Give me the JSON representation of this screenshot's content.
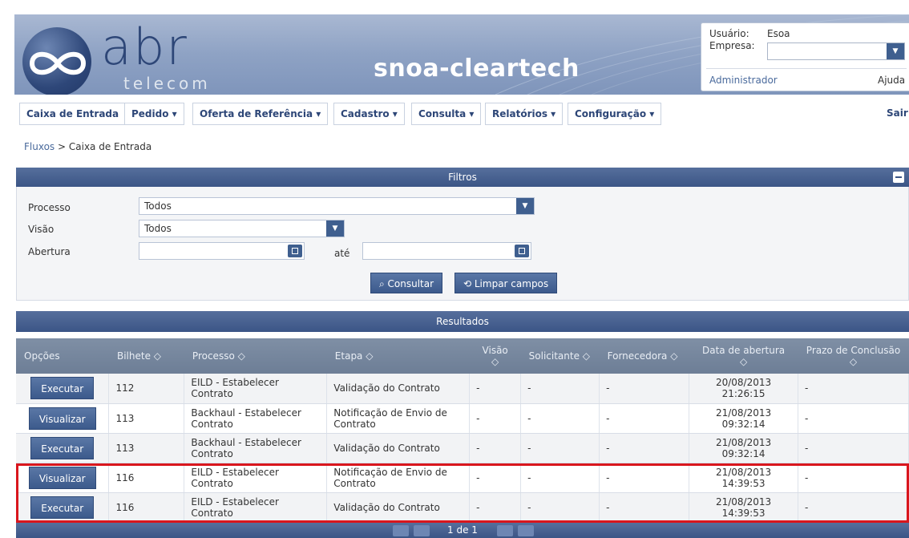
{
  "header": {
    "brand": "abr",
    "brand_sub": "telecom",
    "app_title": "snoa-cleartech"
  },
  "userbox": {
    "user_label": "Usuário:",
    "user_value": "Esoa",
    "company_label": "Empresa:",
    "company_value": "",
    "role": "Administrador",
    "help": "Ajuda"
  },
  "menu": {
    "items": [
      {
        "label": "Caixa de Entrada"
      },
      {
        "label": "Pedido ▾"
      },
      {
        "label": "Oferta de Referência ▾"
      },
      {
        "label": "Cadastro ▾"
      },
      {
        "label": "Consulta ▾"
      },
      {
        "label": "Relatórios ▾"
      },
      {
        "label": "Configuração ▾"
      }
    ],
    "exit": "Sair"
  },
  "breadcrumb": {
    "parent": "Fluxos",
    "separator": ">",
    "current": "Caixa de Entrada"
  },
  "filters": {
    "title": "Filtros",
    "processo_label": "Processo",
    "processo_value": "Todos",
    "visao_label": "Visão",
    "visao_value": "Todos",
    "abertura_label": "Abertura",
    "abertura_from": "",
    "ate_label": "até",
    "abertura_to": "",
    "consultar": "⌕ Consultar",
    "limpar": "⟲ Limpar campos"
  },
  "results": {
    "title": "Resultados",
    "columns": [
      "Opções",
      "Bilhete ◇",
      "Processo ◇",
      "Etapa ◇",
      "Visão ◇",
      "Solicitante ◇",
      "Fornecedora ◇",
      "Data de abertura ◇",
      "Prazo de Conclusão ◇"
    ],
    "rows": [
      {
        "action": "Executar",
        "bilhete": "112",
        "processo": "EILD - Estabelecer Contrato",
        "etapa": "Validação do Contrato",
        "visao": "-",
        "solicitante": "-",
        "fornecedora": "-",
        "data": "20/08/2013 21:26:15",
        "prazo": "-"
      },
      {
        "action": "Visualizar",
        "bilhete": "113",
        "processo": "Backhaul - Estabelecer Contrato",
        "etapa": "Notificação de Envio de Contrato",
        "visao": "-",
        "solicitante": "-",
        "fornecedora": "-",
        "data": "21/08/2013 09:32:14",
        "prazo": "-"
      },
      {
        "action": "Executar",
        "bilhete": "113",
        "processo": "Backhaul - Estabelecer Contrato",
        "etapa": "Validação do Contrato",
        "visao": "-",
        "solicitante": "-",
        "fornecedora": "-",
        "data": "21/08/2013 09:32:14",
        "prazo": "-"
      },
      {
        "action": "Visualizar",
        "bilhete": "116",
        "processo": "EILD - Estabelecer Contrato",
        "etapa": "Notificação de Envio de Contrato",
        "visao": "-",
        "solicitante": "-",
        "fornecedora": "-",
        "data": "21/08/2013 14:39:53",
        "prazo": "-"
      },
      {
        "action": "Executar",
        "bilhete": "116",
        "processo": "EILD - Estabelecer Contrato",
        "etapa": "Validação do Contrato",
        "visao": "-",
        "solicitante": "-",
        "fornecedora": "-",
        "data": "21/08/2013 14:39:53",
        "prazo": "-"
      }
    ]
  },
  "pager": {
    "text": "1 de 1"
  },
  "colors": {
    "brand_blue": "#2d4677",
    "panel_blue": "#3b5586",
    "highlight_red": "#d9161d"
  }
}
